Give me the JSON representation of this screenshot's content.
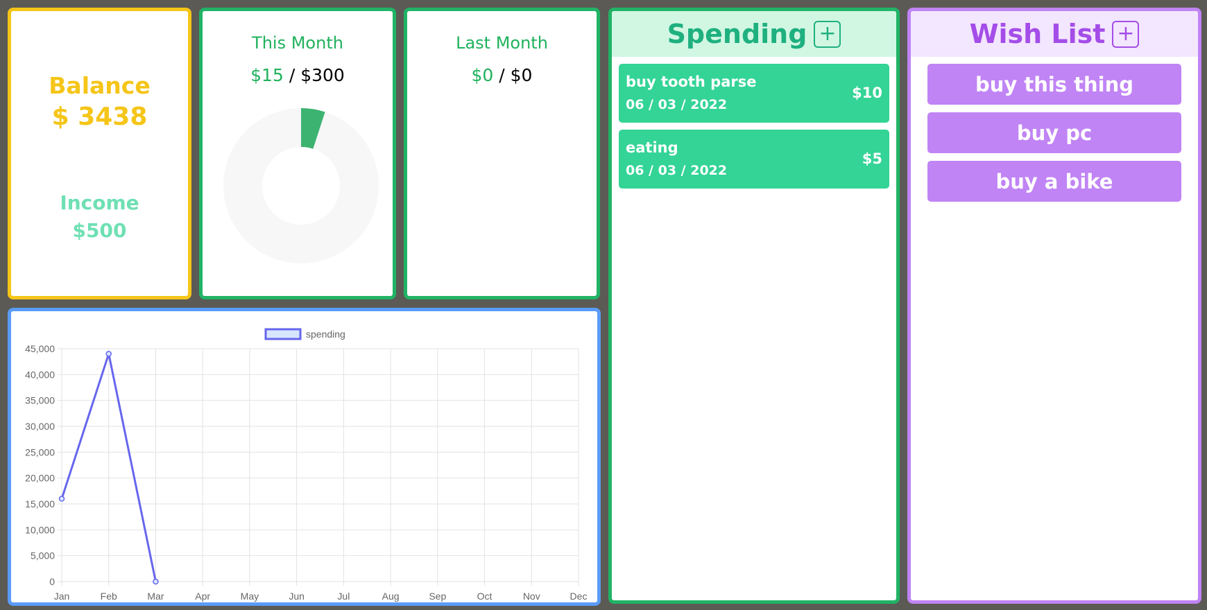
{
  "balance": {
    "label": "Balance",
    "value": "$ 3438"
  },
  "income": {
    "label": "Income",
    "value": "$500"
  },
  "this_month": {
    "title": "This Month",
    "spent": "$15",
    "separator": " / ",
    "budget": "$300",
    "fraction": 0.05
  },
  "last_month": {
    "title": "Last Month",
    "spent": "$0",
    "separator": " / ",
    "budget": "$0"
  },
  "spending": {
    "title": "Spending",
    "add_label": "+",
    "items": [
      {
        "name": "buy tooth parse",
        "date": "06 / 03 / 2022",
        "amount": "$10"
      },
      {
        "name": "eating",
        "date": "06 / 03 / 2022",
        "amount": "$5"
      }
    ]
  },
  "wish_list": {
    "title": "Wish List",
    "add_label": "+",
    "items": [
      {
        "label": "buy this thing"
      },
      {
        "label": "buy pc"
      },
      {
        "label": "buy a bike"
      }
    ]
  },
  "colors": {
    "balance": "#f5c518",
    "income": "#6fe0b4",
    "month": "#1fb25c",
    "donut_fill": "#3cb371",
    "donut_track": "#f7f7f7",
    "chart_line": "#6666ee"
  },
  "chart_data": {
    "type": "line",
    "legend": "spending",
    "legend_position": "top",
    "grid": true,
    "categories": [
      "Jan",
      "Feb",
      "Mar",
      "Apr",
      "May",
      "Jun",
      "Jul",
      "Aug",
      "Sep",
      "Oct",
      "Nov",
      "Dec"
    ],
    "series": [
      {
        "name": "spending",
        "values": [
          16000,
          44000,
          0,
          null,
          null,
          null,
          null,
          null,
          null,
          null,
          null,
          null
        ]
      }
    ],
    "yticks": [
      "0",
      "5,000",
      "10,000",
      "15,000",
      "20,000",
      "25,000",
      "30,000",
      "35,000",
      "40,000",
      "45,000"
    ],
    "ylim": [
      0,
      45000
    ]
  }
}
